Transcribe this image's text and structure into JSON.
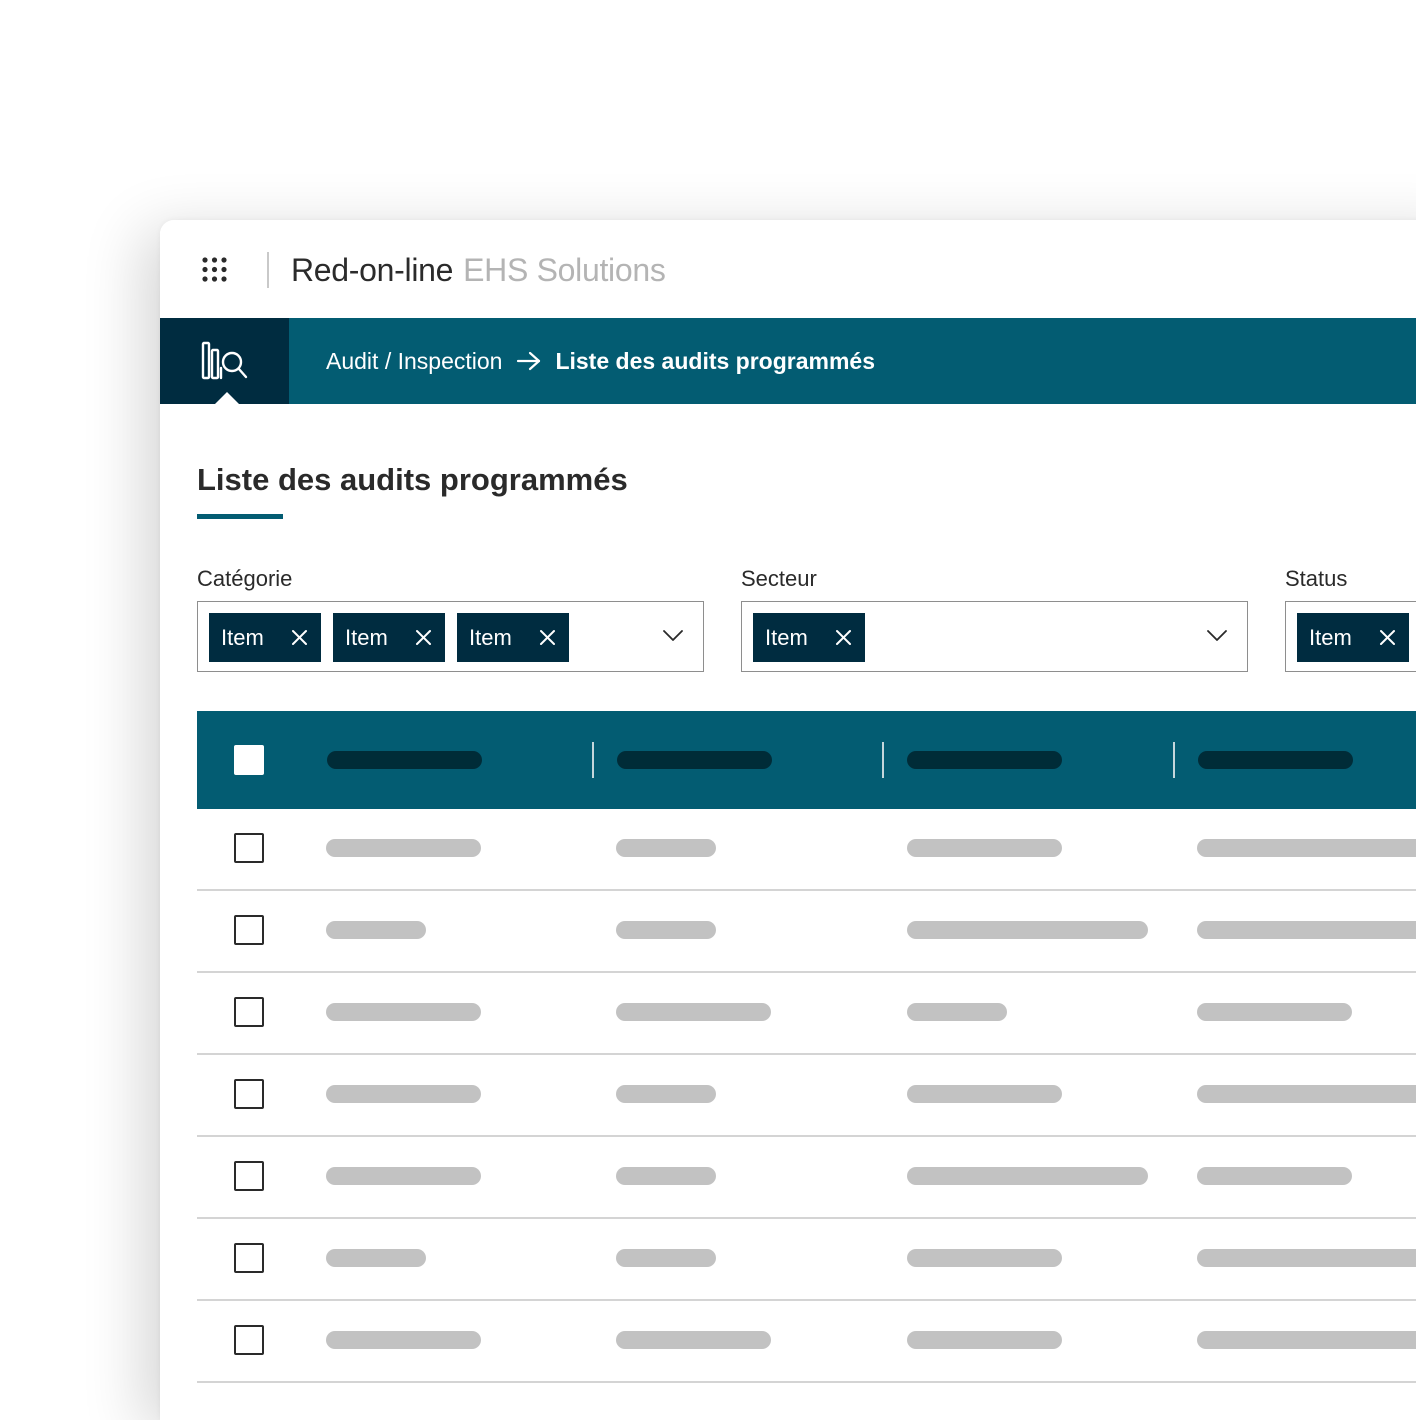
{
  "app": {
    "brand_main": "Red-on-line",
    "brand_sub": "EHS Solutions"
  },
  "nav": {
    "module_icon": "audit-inspection-icon",
    "breadcrumb_parent": "Audit / Inspection",
    "breadcrumb_current": "Liste des audits programmés"
  },
  "page": {
    "title": "Liste des audits programmés"
  },
  "filters": {
    "categorie": {
      "label": "Catégorie",
      "chips": [
        "Item",
        "Item",
        "Item"
      ]
    },
    "secteur": {
      "label": "Secteur",
      "chips": [
        "Item"
      ]
    },
    "status": {
      "label": "Status",
      "chips": [
        "Item"
      ]
    }
  },
  "colors": {
    "primary": "#035c72",
    "dark": "#002c40",
    "skeleton": "#c2c2c2"
  },
  "table": {
    "columns": 4,
    "rows": 7
  }
}
